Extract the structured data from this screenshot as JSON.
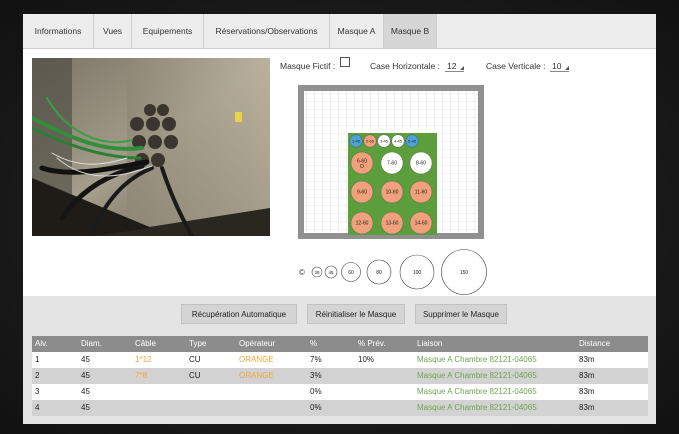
{
  "tabs": [
    {
      "label": "Informations",
      "active": false
    },
    {
      "label": "Vues",
      "active": false
    },
    {
      "label": "Equipements",
      "active": false
    },
    {
      "label": "Réservations/Observations",
      "active": false
    },
    {
      "label": "Masque A",
      "active": false
    },
    {
      "label": "Masque B",
      "active": true
    }
  ],
  "controls": {
    "fictif_label": "Masque Fictif :",
    "fictif_checked": false,
    "horiz_label": "Case Horizontale :",
    "horiz_value": "12",
    "vert_label": "Case Verticale :",
    "vert_value": "10"
  },
  "mask": {
    "small_holes": [
      "1-45",
      "2-60",
      "3-45",
      "4-45",
      "5-45"
    ],
    "big_holes": [
      {
        "label": "6-60",
        "state": "salmon",
        "marker": "O"
      },
      {
        "label": "7-60",
        "state": "white"
      },
      {
        "label": "8-60",
        "state": "white"
      },
      {
        "label": "9-60",
        "state": "salmon"
      },
      {
        "label": "10-60",
        "state": "salmon"
      },
      {
        "label": "11-60",
        "state": "salmon"
      },
      {
        "label": "12-60",
        "state": "salmon"
      },
      {
        "label": "13-60",
        "state": "salmon"
      },
      {
        "label": "14-60",
        "state": "salmon"
      }
    ],
    "colors": {
      "frame": "#909090",
      "plate": "#5c9e3c",
      "salmon": "#f0a07a",
      "blue": "#4ea3d6",
      "grid": "#c9c9c9"
    }
  },
  "sizes": {
    "copyright": "©",
    "items": [
      "28",
      "45",
      "60",
      "80",
      "100",
      "150"
    ]
  },
  "buttons": {
    "auto": "Récupération Automatique",
    "reset": "Réinitialiser le Masque",
    "delete": "Supprimer le Masque"
  },
  "table": {
    "headers": [
      "Alv.",
      "Diam.",
      "Câble",
      "Type",
      "Opérateur",
      "%",
      "% Prév.",
      "Liaison",
      "Distance"
    ],
    "rows": [
      {
        "alv": "1",
        "diam": "45",
        "cable": "1*12",
        "type": "CU",
        "operateur": "ORANGE",
        "pct": "7%",
        "prev": "10%",
        "liaison": "Masque A Chambre 82121-04065",
        "distance": "83m"
      },
      {
        "alv": "2",
        "diam": "45",
        "cable": "7*8",
        "type": "CU",
        "operateur": "ORANGE",
        "pct": "3%",
        "prev": "",
        "liaison": "Masque A Chambre 82121-04065",
        "distance": "83m"
      },
      {
        "alv": "3",
        "diam": "45",
        "cable": "",
        "type": "",
        "operateur": "",
        "pct": "0%",
        "prev": "",
        "liaison": "Masque A Chambre 82121-04065",
        "distance": "83m"
      },
      {
        "alv": "4",
        "diam": "45",
        "cable": "",
        "type": "",
        "operateur": "",
        "pct": "0%",
        "prev": "",
        "liaison": "Masque A Chambre 82121-04065",
        "distance": "83m"
      }
    ]
  }
}
